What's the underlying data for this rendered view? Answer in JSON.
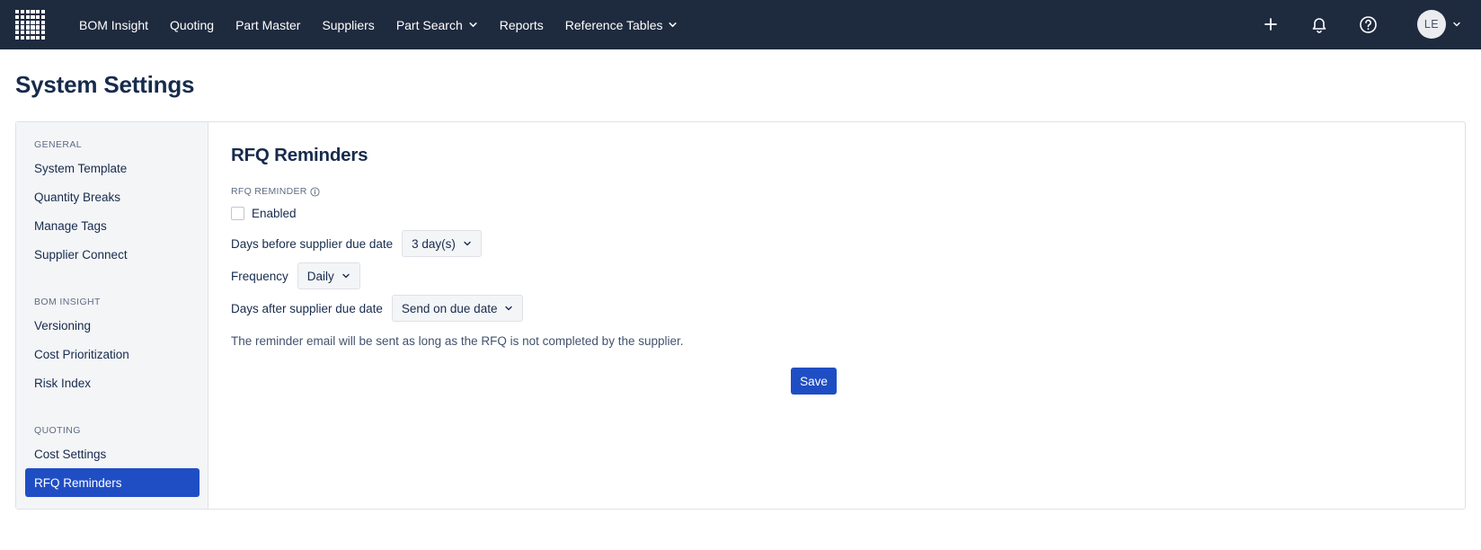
{
  "nav": {
    "items": [
      {
        "label": "BOM Insight",
        "has_chevron": false
      },
      {
        "label": "Quoting",
        "has_chevron": false
      },
      {
        "label": "Part Master",
        "has_chevron": false
      },
      {
        "label": "Suppliers",
        "has_chevron": false
      },
      {
        "label": "Part Search",
        "has_chevron": true
      },
      {
        "label": "Reports",
        "has_chevron": false
      },
      {
        "label": "Reference Tables",
        "has_chevron": true
      }
    ],
    "avatar_initials": "LE"
  },
  "page": {
    "title": "System Settings"
  },
  "sidebar": {
    "sections": [
      {
        "heading": "GENERAL",
        "items": [
          "System Template",
          "Quantity Breaks",
          "Manage Tags",
          "Supplier Connect"
        ]
      },
      {
        "heading": "BOM INSIGHT",
        "items": [
          "Versioning",
          "Cost Prioritization",
          "Risk Index"
        ]
      },
      {
        "heading": "QUOTING",
        "items": [
          "Cost Settings",
          "RFQ Reminders"
        ]
      }
    ],
    "active_item": "RFQ Reminders"
  },
  "content": {
    "title": "RFQ Reminders",
    "field_label": "RFQ REMINDER",
    "enabled_label": "Enabled",
    "enabled_checked": false,
    "days_before_label": "Days before supplier due date",
    "days_before_value": "3 day(s)",
    "frequency_label": "Frequency",
    "frequency_value": "Daily",
    "days_after_label": "Days after supplier due date",
    "days_after_value": "Send on due date",
    "note": "The reminder email will be sent as long as the RFQ is not completed by the supplier.",
    "save_label": "Save"
  },
  "colors": {
    "topbar": "#1e2a3e",
    "accent": "#1f4ec4"
  }
}
